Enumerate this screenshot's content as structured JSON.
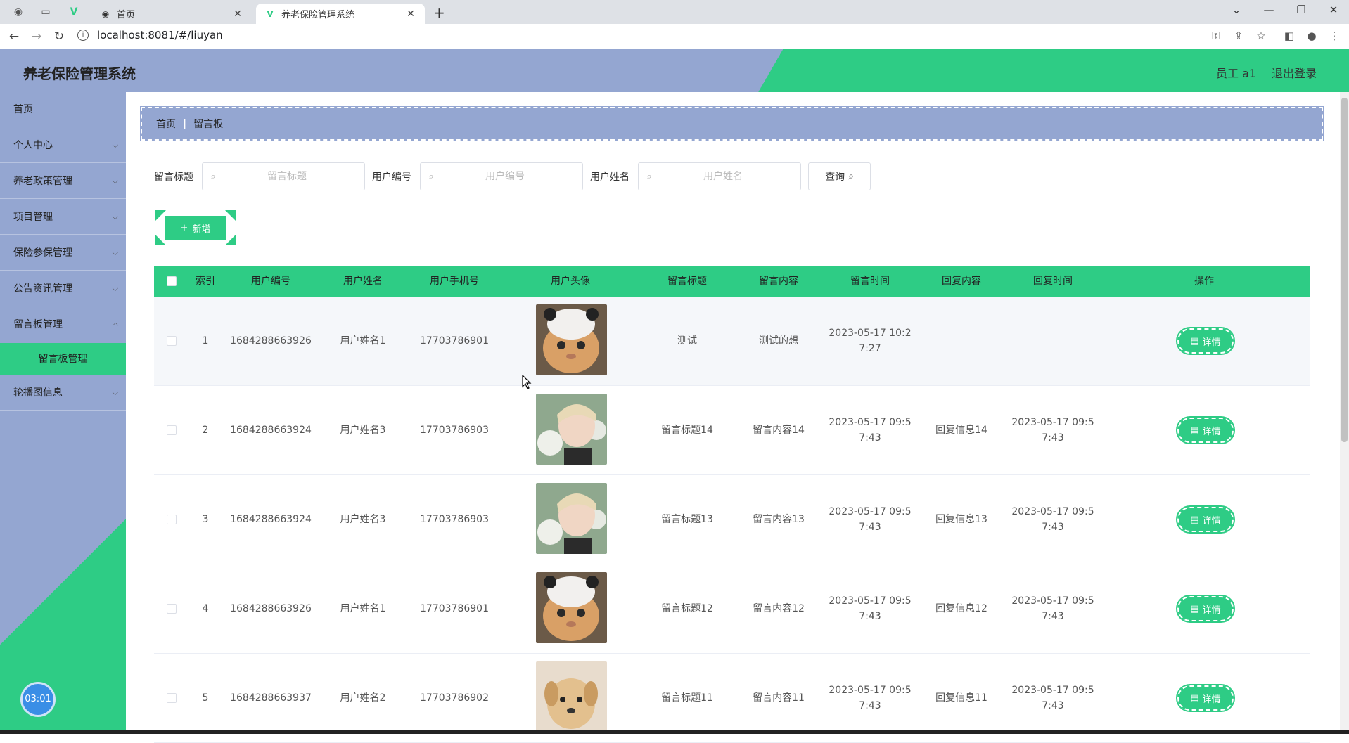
{
  "browser": {
    "tabs": [
      {
        "title": "首页"
      },
      {
        "title": "养老保险管理系统"
      }
    ],
    "url": "localhost:8081/#/liuyan"
  },
  "header": {
    "title": "养老保险管理系统",
    "user": "员工 a1",
    "logout": "退出登录"
  },
  "sidebar": {
    "items": [
      {
        "label": "首页"
      },
      {
        "label": "个人中心"
      },
      {
        "label": "养老政策管理"
      },
      {
        "label": "项目管理"
      },
      {
        "label": "保险参保管理"
      },
      {
        "label": "公告资讯管理"
      },
      {
        "label": "留言板管理"
      },
      {
        "label": "留言板管理"
      },
      {
        "label": "轮播图信息"
      }
    ],
    "timer": "03:01"
  },
  "breadcrumb": [
    "首页",
    "留言板"
  ],
  "search": {
    "title_label": "留言标题",
    "title_placeholder": "留言标题",
    "userno_label": "用户编号",
    "userno_placeholder": "用户编号",
    "username_label": "用户姓名",
    "username_placeholder": "用户姓名",
    "query_label": "查询"
  },
  "actions": {
    "add_label": "新增"
  },
  "table": {
    "columns": [
      "索引",
      "用户编号",
      "用户姓名",
      "用户手机号",
      "用户头像",
      "留言标题",
      "留言内容",
      "留言时间",
      "回复内容",
      "回复时间",
      "操作"
    ],
    "detail_label": "详情",
    "rows": [
      {
        "index": "1",
        "user_no": "1684288663926",
        "user_name": "用户姓名1",
        "phone": "17703786901",
        "avatar": "cat",
        "title": "测试",
        "content": "测试的想",
        "time1": "2023-05-17 10:2",
        "time2": "7:27",
        "reply": "",
        "rtime1": "",
        "rtime2": ""
      },
      {
        "index": "2",
        "user_no": "1684288663924",
        "user_name": "用户姓名3",
        "phone": "17703786903",
        "avatar": "person",
        "title": "留言标题14",
        "content": "留言内容14",
        "time1": "2023-05-17 09:5",
        "time2": "7:43",
        "reply": "回复信息14",
        "rtime1": "2023-05-17 09:5",
        "rtime2": "7:43"
      },
      {
        "index": "3",
        "user_no": "1684288663924",
        "user_name": "用户姓名3",
        "phone": "17703786903",
        "avatar": "person",
        "title": "留言标题13",
        "content": "留言内容13",
        "time1": "2023-05-17 09:5",
        "time2": "7:43",
        "reply": "回复信息13",
        "rtime1": "2023-05-17 09:5",
        "rtime2": "7:43"
      },
      {
        "index": "4",
        "user_no": "1684288663926",
        "user_name": "用户姓名1",
        "phone": "17703786901",
        "avatar": "cat",
        "title": "留言标题12",
        "content": "留言内容12",
        "time1": "2023-05-17 09:5",
        "time2": "7:43",
        "reply": "回复信息12",
        "rtime1": "2023-05-17 09:5",
        "rtime2": "7:43"
      },
      {
        "index": "5",
        "user_no": "1684288663937",
        "user_name": "用户姓名2",
        "phone": "17703786902",
        "avatar": "puppy",
        "title": "留言标题11",
        "content": "留言内容11",
        "time1": "2023-05-17 09:5",
        "time2": "7:43",
        "reply": "回复信息11",
        "rtime1": "2023-05-17 09:5",
        "rtime2": "7:43"
      }
    ]
  },
  "colors": {
    "primary": "#2ecc85",
    "secondary": "#94a6d1"
  }
}
